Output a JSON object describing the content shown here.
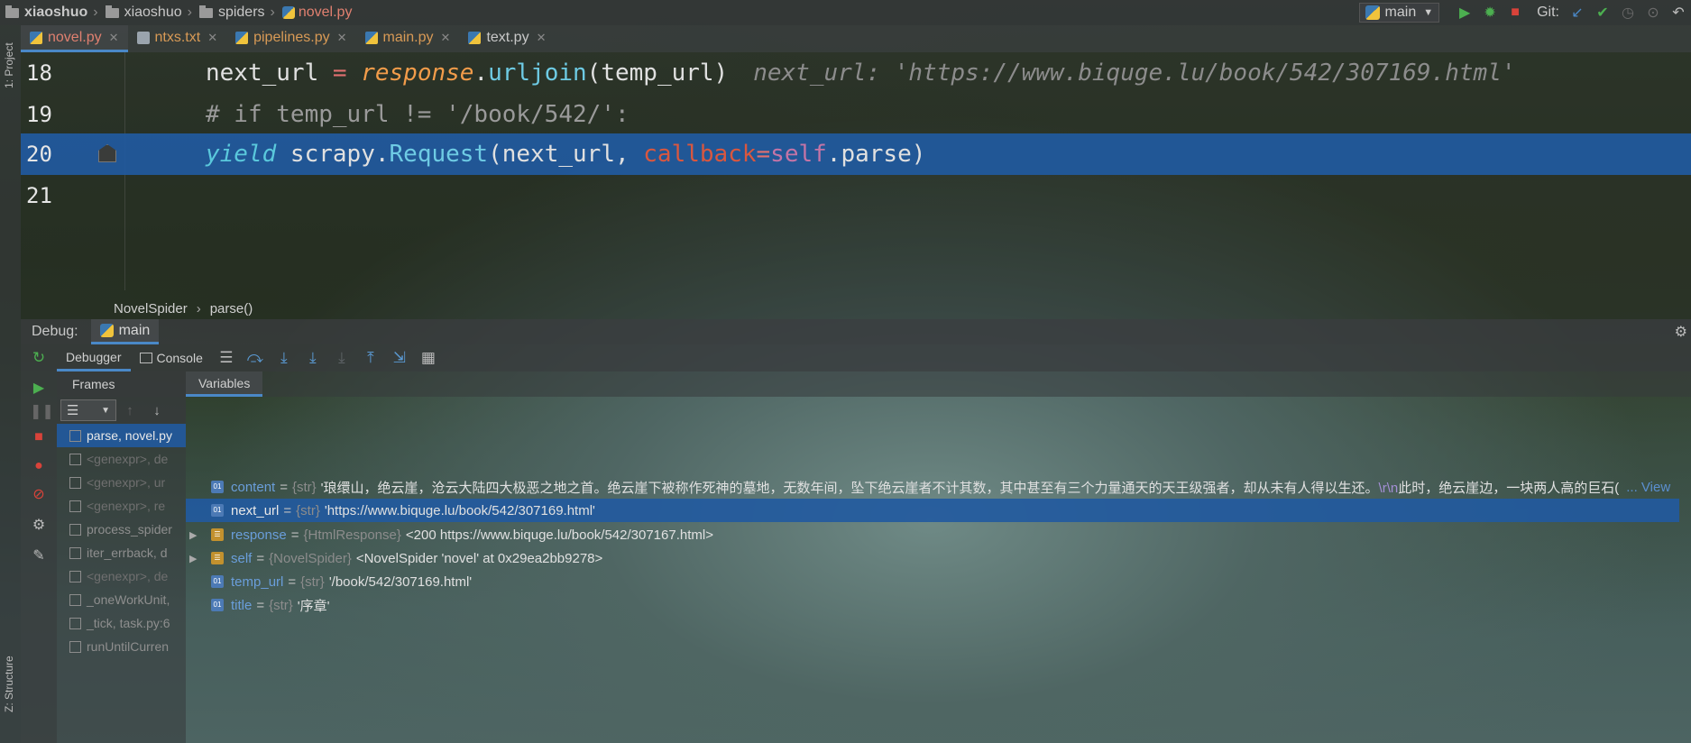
{
  "breadcrumb": {
    "project": "xiaoshuo",
    "folder": "xiaoshuo",
    "subfolder": "spiders",
    "file": "novel.py"
  },
  "toolbar": {
    "run_config": "main",
    "git_label": "Git:"
  },
  "sidebar": {
    "project_label": "1: Project",
    "structure_label": "Z: Structure"
  },
  "tabs": [
    {
      "label": "novel.py"
    },
    {
      "label": "ntxs.txt"
    },
    {
      "label": "pipelines.py"
    },
    {
      "label": "main.py"
    },
    {
      "label": "text.py"
    }
  ],
  "editor": {
    "lines": [
      {
        "number": "18"
      },
      {
        "number": "19"
      },
      {
        "number": "20"
      },
      {
        "number": "21"
      }
    ],
    "line18": {
      "var": "next_url",
      "eq": " = ",
      "obj": "response",
      "dot": ".",
      "method": "urljoin",
      "args": "(temp_url)",
      "inlay": "next_url: 'https://www.biquge.lu/book/542/307169.html'"
    },
    "line19": {
      "comment": "# if temp_url != '/book/542/':"
    },
    "line20": {
      "yield": "yield",
      "space1": " scrapy.",
      "request": "Request",
      "args1": "(next_url, ",
      "param": "callback",
      "eqsign": "=",
      "selfkw": "self",
      "rest": ".parse)"
    },
    "structure": {
      "class_name": "NovelSpider",
      "method_name": "parse()"
    }
  },
  "debug": {
    "label": "Debug:",
    "session": "main",
    "tabs": {
      "debugger": "Debugger",
      "console": "Console"
    },
    "frames_header": "Frames",
    "variables_header": "Variables",
    "frames": [
      "parse, novel.py",
      "<genexpr>, de",
      "<genexpr>, ur",
      "<genexpr>, re",
      "process_spider",
      "iter_errback, d",
      "<genexpr>, de",
      "_oneWorkUnit,",
      "_tick, task.py:6",
      "runUntilCurren"
    ],
    "variables": [
      {
        "name": "content",
        "type": "{str}",
        "value": "'琅缳山，绝云崖，沧云大陆四大极恶之地之首。绝云崖下被称作死神的墓地，无数年间，坠下绝云崖者不计其数，其中甚至有三个力量通天的天王级强者，却从未有人得以生还。",
        "escape": "\\r\\n",
        "value2": "此时，绝云崖边，一块两人高的巨石(",
        "link": "... View"
      },
      {
        "name": "next_url",
        "type": "{str}",
        "value": "'https://www.biquge.lu/book/542/307169.html'"
      },
      {
        "name": "response",
        "type": "{HtmlResponse}",
        "value": "<200 https://www.biquge.lu/book/542/307167.html>"
      },
      {
        "name": "self",
        "type": "{NovelSpider}",
        "value": "<NovelSpider 'novel' at 0x29ea2bb9278>"
      },
      {
        "name": "temp_url",
        "type": "{str}",
        "value": "'/book/542/307169.html'"
      },
      {
        "name": "title",
        "type": "{str}",
        "value": "'序章'"
      }
    ]
  },
  "icons": {
    "folder": "folder-icon",
    "python": "python-file-icon",
    "run": "run-icon",
    "debug": "debug-icon",
    "stop": "stop-icon"
  },
  "colors": {
    "highlight": "#215aa0",
    "accent": "#4a88c7",
    "run_green": "#4caf50",
    "stop_red": "#d9433a"
  }
}
